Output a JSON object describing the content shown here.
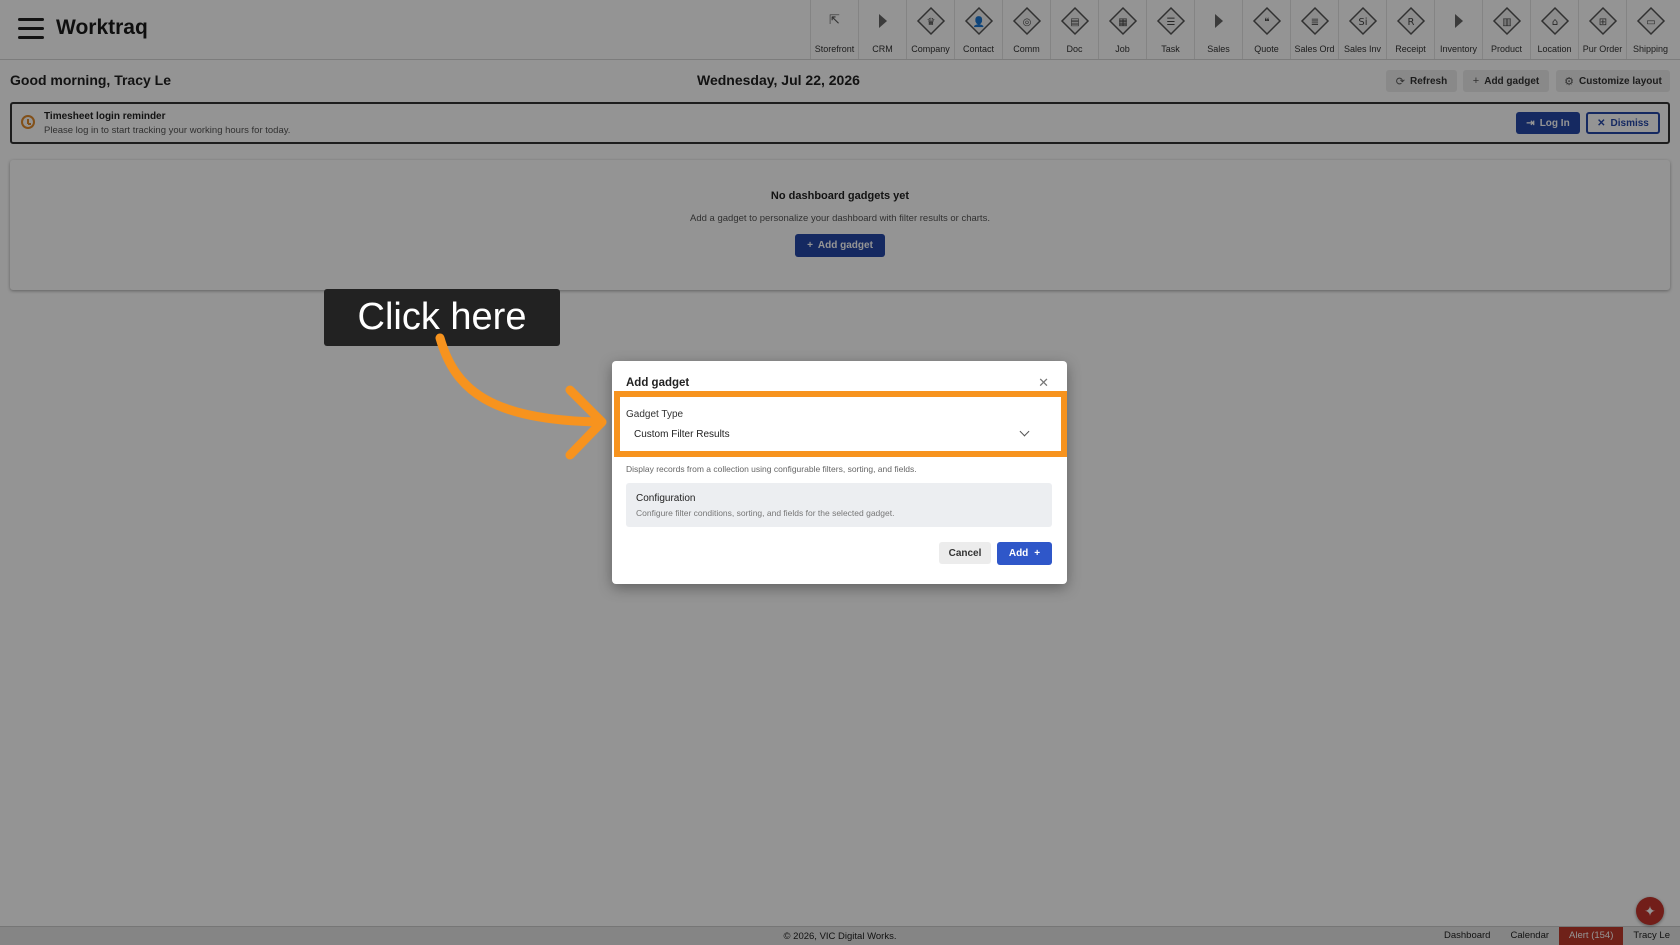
{
  "app": {
    "title": "Worktraq"
  },
  "nav": {
    "items": [
      {
        "label": "Storefront",
        "icon": "external-link-icon"
      },
      {
        "label": "CRM",
        "icon": "section-arrow-icon"
      },
      {
        "label": "Company",
        "icon": "company-icon"
      },
      {
        "label": "Contact",
        "icon": "contact-icon"
      },
      {
        "label": "Comm",
        "icon": "communication-icon"
      },
      {
        "label": "Doc",
        "icon": "document-icon"
      },
      {
        "label": "Job",
        "icon": "job-icon"
      },
      {
        "label": "Task",
        "icon": "task-icon"
      },
      {
        "label": "Sales",
        "icon": "section-arrow-icon"
      },
      {
        "label": "Quote",
        "icon": "quote-icon"
      },
      {
        "label": "Sales Ord",
        "icon": "sales-order-icon"
      },
      {
        "label": "Sales Inv",
        "icon": "sales-invoice-icon"
      },
      {
        "label": "Receipt",
        "icon": "receipt-icon"
      },
      {
        "label": "Inventory",
        "icon": "section-arrow-icon"
      },
      {
        "label": "Product",
        "icon": "product-icon"
      },
      {
        "label": "Location",
        "icon": "location-icon"
      },
      {
        "label": "Pur Order",
        "icon": "purchase-order-icon"
      },
      {
        "label": "Shipping",
        "icon": "shipping-icon"
      }
    ]
  },
  "header": {
    "greeting": "Good morning, Tracy Le",
    "date": "Wednesday, Jul 22, 2026",
    "refresh_label": "Refresh",
    "add_gadget_label": "Add gadget",
    "customize_label": "Customize layout"
  },
  "reminder": {
    "title": "Timesheet login reminder",
    "text": "Please log in to start tracking your working hours for today.",
    "login_label": "Log In",
    "dismiss_label": "Dismiss"
  },
  "empty_state": {
    "title": "No dashboard gadgets yet",
    "text": "Add a gadget to personalize your dashboard with filter results or charts.",
    "button_label": "Add gadget"
  },
  "modal": {
    "title": "Add gadget",
    "gadget_type_label": "Gadget Type",
    "gadget_type_value": "Custom Filter Results",
    "gadget_description": "Display records from a collection using configurable filters, sorting, and fields.",
    "config_title": "Configuration",
    "config_text": "Configure filter conditions, sorting, and fields for the selected gadget.",
    "cancel_label": "Cancel",
    "add_label": "Add"
  },
  "tutorial": {
    "callout_text": "Click here",
    "highlight_color": "#f7931e"
  },
  "footer": {
    "copyright": "© 2026, VIC Digital Works.",
    "links": [
      "Dashboard",
      "Calendar",
      "Alert (154)",
      "Tracy Le"
    ]
  },
  "colors": {
    "primary": "#2547a8",
    "alert": "#c0392b",
    "accent": "#f7931e"
  }
}
